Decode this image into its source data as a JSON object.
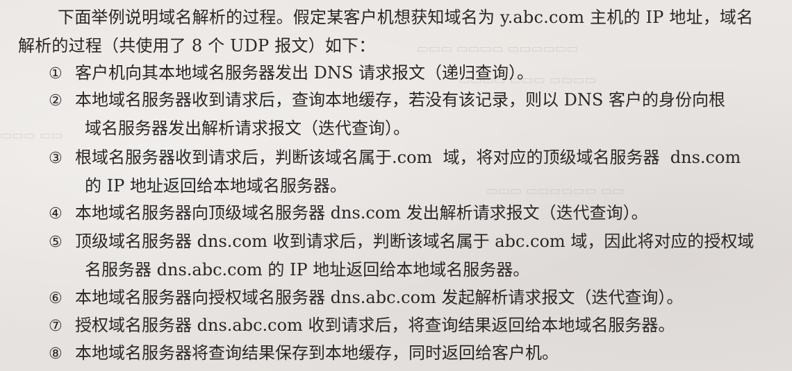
{
  "intro": {
    "line1": "下面举例说明域名解析的过程。假定某客户机想获知域名为 y.abc.com 主机的 IP 地址，域名",
    "line2": "解析的过程（共使用了 8 个 UDP 报文）如下："
  },
  "steps": [
    {
      "num": "①",
      "lines": [
        "客户机向其本地域名服务器发出 DNS 请求报文（递归查询）。"
      ]
    },
    {
      "num": "②",
      "lines": [
        "本地域名服务器收到请求后，查询本地缓存，若没有该记录，则以 DNS 客户的身份向根",
        "域名服务器发出解析请求报文（迭代查询）。"
      ]
    },
    {
      "num": "③",
      "lines": [
        "根域名服务器收到请求后，判断该域名属于.com  域，将对应的顶级域名服务器  dns.com",
        "的 IP 地址返回给本地域名服务器。"
      ]
    },
    {
      "num": "④",
      "lines": [
        "本地域名服务器向顶级域名服务器 dns.com 发出解析请求报文（迭代查询）。"
      ]
    },
    {
      "num": "⑤",
      "lines": [
        "顶级域名服务器 dns.com 收到请求后，判断该域名属于 abc.com 域，因此将对应的授权域",
        "名服务器 dns.abc.com 的 IP 地址返回给本地域名服务器。"
      ]
    },
    {
      "num": "⑥",
      "lines": [
        "本地域名服务器向授权域名服务器 dns.abc.com 发起解析请求报文（迭代查询）。"
      ]
    },
    {
      "num": "⑦",
      "lines": [
        "授权域名服务器 dns.abc.com 收到请求后，将查询结果返回给本地域名服务器。"
      ]
    },
    {
      "num": "⑧",
      "lines": [
        "本地域名服务器将查询结果保存到本地缓存，同时返回给客户机。"
      ]
    }
  ],
  "colors": {
    "paper": "#e9e5e2",
    "ink": "#2a2727"
  }
}
